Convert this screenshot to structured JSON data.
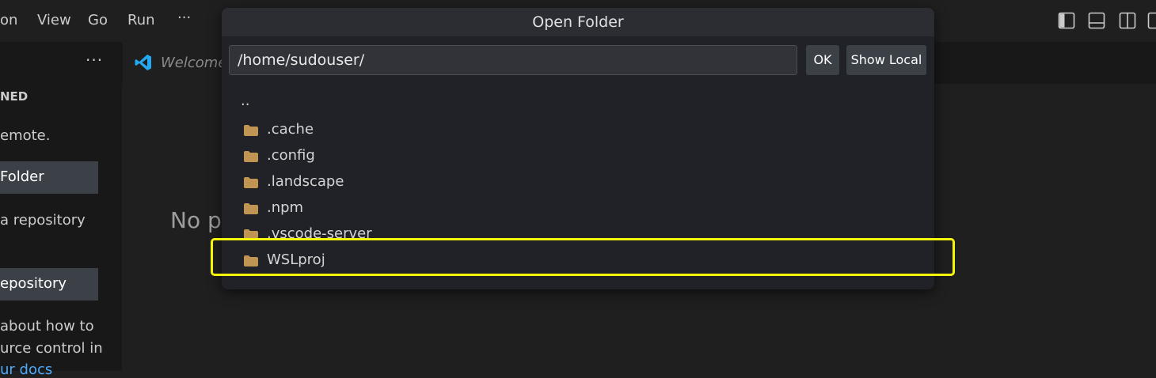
{
  "menu": {
    "items": [
      {
        "label": "on"
      },
      {
        "label": "View"
      },
      {
        "label": "Go"
      },
      {
        "label": "Run"
      },
      {
        "label": "···"
      }
    ]
  },
  "layout_controls": [
    {
      "icon": "toggle-primary-sidebar-icon"
    },
    {
      "icon": "toggle-panel-icon"
    },
    {
      "icon": "toggle-secondary-sidebar-icon"
    },
    {
      "icon": "customize-layout-icon"
    }
  ],
  "sidebar": {
    "more_label": "···",
    "header": "NED",
    "text_remote": "emote.",
    "open_folder_label": "Folder",
    "text_repo": "a repository",
    "clone_label": "epository",
    "text_learn_1": "about how to",
    "text_learn_2": "urce control in",
    "text_learn_3": "ur docs"
  },
  "tab": {
    "label": "Welcome",
    "icon": "vscode-logo-icon"
  },
  "editor": {
    "text": "No p"
  },
  "dialog": {
    "title": "Open Folder",
    "path_value": "/home/sudouser/",
    "ok_label": "OK",
    "show_local_label": "Show Local",
    "parent_entry": "..",
    "folders": [
      {
        "name": ".cache"
      },
      {
        "name": ".config"
      },
      {
        "name": ".landscape"
      },
      {
        "name": ".npm"
      },
      {
        "name": ".vscode-server"
      },
      {
        "name": "WSLproj"
      }
    ]
  },
  "colors": {
    "accent_highlight": "#f5f50a",
    "folder": "#c09553",
    "vscode_blue": "#23a9f2",
    "link": "#4daafc"
  }
}
